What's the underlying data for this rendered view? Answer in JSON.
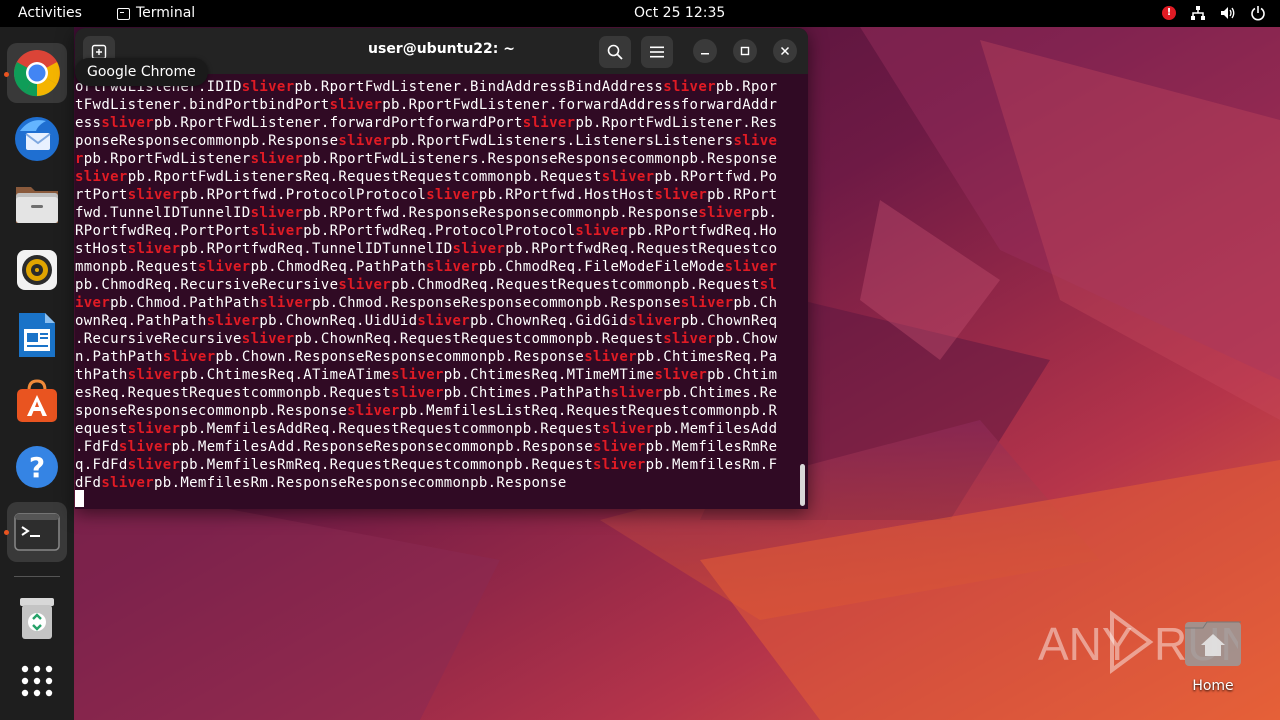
{
  "topbar": {
    "activities": "Activities",
    "app_name": "Terminal",
    "clock": "Oct 25  12:35",
    "alert_badge": "!"
  },
  "tooltip": {
    "text": "Google Chrome"
  },
  "dock": {
    "items": [
      "Google Chrome",
      "Thunderbird Mail",
      "Files",
      "Rhythmbox",
      "LibreOffice Writer",
      "Ubuntu Software",
      "Help",
      "Terminal",
      "Trash",
      "Show Applications"
    ]
  },
  "terminal": {
    "title": "user@ubuntu22: ~",
    "output_lines": [
      "ortFwdListener.IDID[[sliver]]pb.RportFwdListener.BindAddressBindAddress[[sliver]]pb.Rpor",
      "tFwdListener.bindPortbindPort[[sliver]]pb.RportFwdListener.forwardAddressforwardAddr",
      "ess[[sliver]]pb.RportFwdListener.forwardPortforwardPort[[sliver]]pb.RportFwdListener.Res",
      "ponseResponsecommonpb.Response[[sliver]]pb.RportFwdListeners.ListenersListeners[[slive]]",
      "[[r]]pb.RportFwdListener[[sliver]]pb.RportFwdListeners.ResponseResponsecommonpb.Response",
      "[[sliver]]pb.RportFwdListenersReq.RequestRequestcommonpb.Request[[sliver]]pb.RPortfwd.Po",
      "rtPort[[sliver]]pb.RPortfwd.ProtocolProtocol[[sliver]]pb.RPortfwd.HostHost[[sliver]]pb.RPort",
      "fwd.TunnelIDTunnelID[[sliver]]pb.RPortfwd.ResponseResponsecommonpb.Response[[sliver]]pb.",
      "RPortfwdReq.PortPort[[sliver]]pb.RPortfwdReq.ProtocolProtocol[[sliver]]pb.RPortfwdReq.Ho",
      "stHost[[sliver]]pb.RPortfwdReq.TunnelIDTunnelID[[sliver]]pb.RPortfwdReq.RequestRequestco",
      "mmonpb.Request[[sliver]]pb.ChmodReq.PathPath[[sliver]]pb.ChmodReq.FileModeFileMode[[sliver]]",
      "pb.ChmodReq.RecursiveRecursive[[sliver]]pb.ChmodReq.RequestRequestcommonpb.Request[[sl]]",
      "[[iver]]pb.Chmod.PathPath[[sliver]]pb.Chmod.ResponseResponsecommonpb.Response[[sliver]]pb.Ch",
      "ownReq.PathPath[[sliver]]pb.ChownReq.UidUid[[sliver]]pb.ChownReq.GidGid[[sliver]]pb.ChownReq",
      ".RecursiveRecursive[[sliver]]pb.ChownReq.RequestRequestcommonpb.Request[[sliver]]pb.Chow",
      "n.PathPath[[sliver]]pb.Chown.ResponseResponsecommonpb.Response[[sliver]]pb.ChtimesReq.Pa",
      "thPath[[sliver]]pb.ChtimesReq.ATimeATime[[sliver]]pb.ChtimesReq.MTimeMTime[[sliver]]pb.Chtim",
      "esReq.RequestRequestcommonpb.Request[[sliver]]pb.Chtimes.PathPath[[sliver]]pb.Chtimes.Re",
      "sponseResponsecommonpb.Response[[sliver]]pb.MemfilesListReq.RequestRequestcommonpb.R",
      "equest[[sliver]]pb.MemfilesAddReq.RequestRequestcommonpb.Request[[sliver]]pb.MemfilesAdd",
      ".FdFd[[sliver]]pb.MemfilesAdd.ResponseResponsecommonpb.Response[[sliver]]pb.MemfilesRmRe",
      "q.FdFd[[sliver]]pb.MemfilesRmReq.RequestRequestcommonpb.Request[[sliver]]pb.MemfilesRm.F",
      "dFd[[sliver]]pb.MemfilesRm.ResponseResponsecommonpb.Response"
    ]
  },
  "desktop": {
    "home_label": "Home"
  },
  "watermark": {
    "text_left": "ANY",
    "text_right": "RUN"
  },
  "colors": {
    "accent": "#e95420",
    "highlight": "#e01b24",
    "terminal_bg": "#300a24"
  },
  "icons": [
    "new-tab-icon",
    "search-icon",
    "hamburger-menu-icon",
    "minimize-icon",
    "maximize-icon",
    "close-icon",
    "network-icon",
    "volume-icon",
    "power-icon"
  ]
}
